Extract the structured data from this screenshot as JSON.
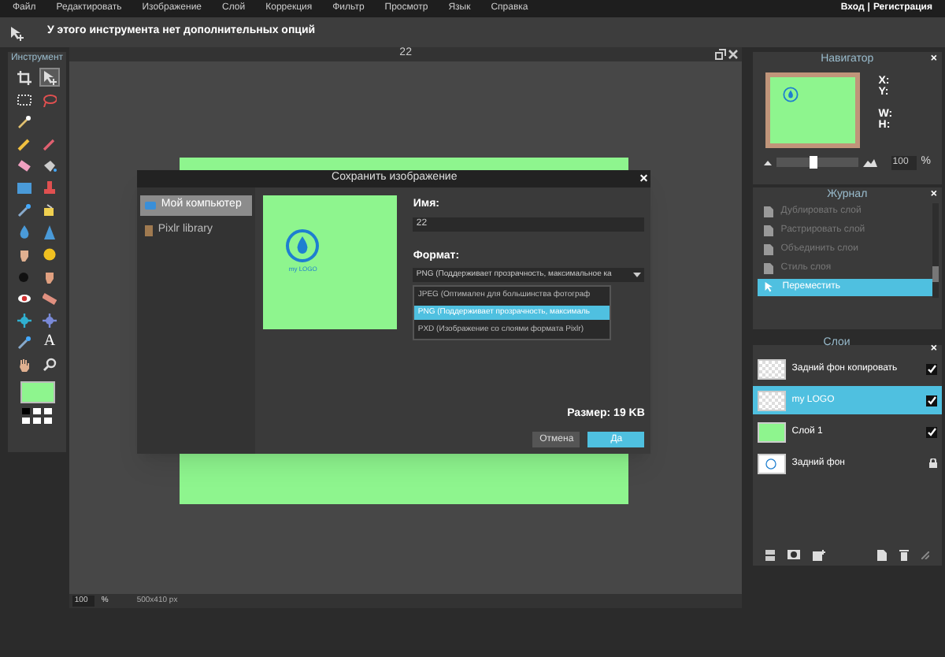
{
  "menu_bar": {
    "items": [
      "Файл",
      "Редактировать",
      "Изображение",
      "Слой",
      "Коррекция",
      "Фильтр",
      "Просмотр",
      "Язык",
      "Справка"
    ],
    "links": [
      "Вход",
      "|",
      "Регистрация"
    ]
  },
  "options_bar": {
    "message": "У этого инструмента нет дополнительных опций"
  },
  "toolbox": {
    "title": "Инструмент",
    "tools": [
      {
        "kind": "crop",
        "selected": false
      },
      {
        "kind": "move",
        "selected": true
      },
      {
        "kind": "marquee",
        "selected": false
      },
      {
        "kind": "lasso",
        "selected": false
      },
      {
        "kind": "wand",
        "selected": false
      },
      {
        "kind": "pencil",
        "selected": false
      },
      {
        "kind": "brush",
        "selected": false
      },
      {
        "kind": "eraser",
        "selected": false
      },
      {
        "kind": "bucket",
        "selected": false
      },
      {
        "kind": "gradient",
        "selected": false
      },
      {
        "kind": "stamp",
        "selected": false
      },
      {
        "kind": "picker",
        "selected": false
      },
      {
        "kind": "replace",
        "selected": false
      },
      {
        "kind": "drop",
        "selected": false
      },
      {
        "kind": "sharpen",
        "selected": false
      },
      {
        "kind": "smudge",
        "selected": false
      },
      {
        "kind": "sponge",
        "selected": false
      },
      {
        "kind": "burn",
        "selected": false
      },
      {
        "kind": "dodge",
        "selected": false
      },
      {
        "kind": "redeye",
        "selected": false
      },
      {
        "kind": "bandage",
        "selected": false
      },
      {
        "kind": "bloat",
        "selected": false
      },
      {
        "kind": "pinch",
        "selected": false
      },
      {
        "kind": "picker",
        "selected": false
      },
      {
        "kind": "text",
        "selected": false
      },
      {
        "kind": "hand",
        "selected": false
      },
      {
        "kind": "zoom",
        "selected": false
      }
    ],
    "text_glyph": "A"
  },
  "canvas_window": {
    "title": "22",
    "zoom": "100",
    "zoom_unit": "%",
    "dimensions": "500x410 px"
  },
  "dialog": {
    "title": "Сохранить изображение",
    "close": "×",
    "locations": [
      {
        "label": "Мой компьютер",
        "selected": true
      },
      {
        "label": "Pixlr library",
        "selected": false
      }
    ],
    "preview_caption": "my LOGO",
    "name_label": "Имя:",
    "name_value": "22",
    "format_label": "Формат:",
    "format_value": "PNG (Поддерживает прозрачность, максимальное ка",
    "format_options": [
      {
        "label": "JPEG (Оптимален для большинства фотограф",
        "selected": false
      },
      {
        "label": "PNG (Поддерживает прозрачность, максималь",
        "selected": true
      },
      {
        "label": "PXD (Изображение со слоями формата Pixlr)",
        "selected": false
      }
    ],
    "size": "Размер: 19 KB",
    "buttons": [
      {
        "label": "Отмена",
        "kind": "secondary"
      },
      {
        "label": "Да",
        "kind": "primary"
      }
    ]
  },
  "navigator": {
    "title": "Навигатор",
    "close": "×",
    "fields": [
      "X:",
      "Y:",
      "W:",
      "H:"
    ],
    "zoom": {
      "level": 0.45
    },
    "zoom_value": "100",
    "zoom_unit": "%"
  },
  "history": {
    "title": "Журнал",
    "close": "×",
    "items": [
      {
        "label": "Дублировать слой",
        "selected": false
      },
      {
        "label": "Растрировать слой",
        "selected": false
      },
      {
        "label": "Объединить слои",
        "selected": false
      },
      {
        "label": "Стиль слоя",
        "selected": false
      },
      {
        "label": "Переместить",
        "selected": true
      }
    ]
  },
  "layers": {
    "title": "Слои",
    "close": "×",
    "items": [
      {
        "name": "Задний фон копировать",
        "kind": "transparent",
        "selected": false,
        "visible": true,
        "locked": false
      },
      {
        "name": "my LOGO",
        "kind": "transparent",
        "selected": true,
        "visible": true,
        "locked": false
      },
      {
        "name": "Слой 1",
        "kind": "green",
        "selected": false,
        "visible": true,
        "locked": false
      },
      {
        "name": "Задний фон",
        "kind": "logo",
        "selected": false,
        "locked": true
      }
    ]
  }
}
